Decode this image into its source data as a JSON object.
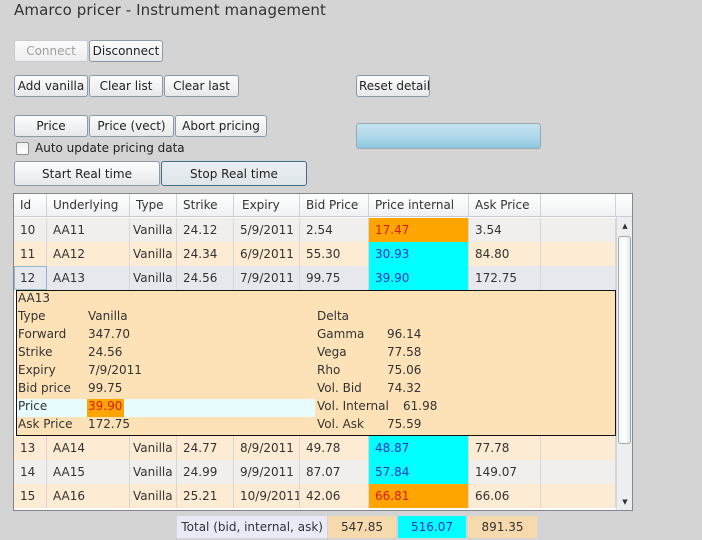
{
  "window": {
    "title": "Amarco pricer - Instrument management"
  },
  "toolbar": {
    "connect": "Connect",
    "disconnect": "Disconnect",
    "add_vanilla": "Add vanilla",
    "clear_list": "Clear list",
    "clear_last": "Clear last",
    "reset_details": "Reset details",
    "price": "Price",
    "price_vect": "Price (vect)",
    "abort_pricing": "Abort pricing",
    "auto_update_label": "Auto update pricing data",
    "auto_update_checked": false,
    "start_real_time": "Start Real time",
    "stop_real_time": "Stop Real time",
    "progress_fraction": 1.0
  },
  "colors": {
    "orange_highlight": "#ffa500",
    "cyan_highlight": "#00ffff",
    "details_background": "#fde2b8"
  },
  "grid": {
    "columns": [
      "Id",
      "Underlying",
      "Type",
      "Strike",
      "Expiry",
      "Bid Price",
      "Price internal",
      "Ask Price"
    ],
    "rows_top": [
      {
        "id": "10",
        "underlying": "AA11",
        "type": "Vanilla",
        "strike": "24.12",
        "expiry": "5/9/2011",
        "bid": "2.54",
        "internal": "17.47",
        "internal_color": "orange",
        "ask": "3.54"
      },
      {
        "id": "11",
        "underlying": "AA12",
        "type": "Vanilla",
        "strike": "24.34",
        "expiry": "6/9/2011",
        "bid": "55.30",
        "internal": "30.93",
        "internal_color": "cyan",
        "ask": "84.80"
      },
      {
        "id": "12",
        "underlying": "AA13",
        "type": "Vanilla",
        "strike": "24.56",
        "expiry": "7/9/2011",
        "bid": "99.75",
        "internal": "39.90",
        "internal_color": "cyan",
        "ask": "172.75"
      }
    ],
    "rows_bottom": [
      {
        "id": "13",
        "underlying": "AA14",
        "type": "Vanilla",
        "strike": "24.77",
        "expiry": "8/9/2011",
        "bid": "49.78",
        "internal": "48.87",
        "internal_color": "cyan",
        "ask": "77.78"
      },
      {
        "id": "14",
        "underlying": "AA15",
        "type": "Vanilla",
        "strike": "24.99",
        "expiry": "9/9/2011",
        "bid": "87.07",
        "internal": "57.84",
        "internal_color": "cyan",
        "ask": "149.07"
      },
      {
        "id": "15",
        "underlying": "AA16",
        "type": "Vanilla",
        "strike": "25.21",
        "expiry": "10/9/2011",
        "bid": "42.06",
        "internal": "66.81",
        "internal_color": "orange",
        "ask": "66.06"
      }
    ]
  },
  "details": {
    "name": "AA13",
    "left": [
      {
        "label": "Type",
        "value": "Vanilla"
      },
      {
        "label": "Forward",
        "value": "347.70"
      },
      {
        "label": "Strike",
        "value": "24.56"
      },
      {
        "label": "Expiry",
        "value": "7/9/2011"
      },
      {
        "label": "Bid price",
        "value": "99.75"
      },
      {
        "label": "Price",
        "value": "39.90"
      },
      {
        "label": "Ask Price",
        "value": "172.75"
      }
    ],
    "right": [
      {
        "label": "Delta",
        "value": ""
      },
      {
        "label": "Gamma",
        "value": "96.14"
      },
      {
        "label": "Vega",
        "value": "77.58"
      },
      {
        "label": "Rho",
        "value": "75.06"
      },
      {
        "label": "Vol. Bid",
        "value": "74.32"
      },
      {
        "label": "Vol. Internal",
        "value": "61.98"
      },
      {
        "label": "Vol. Ask",
        "value": "75.59"
      }
    ]
  },
  "totals": {
    "label": "Total (bid, internal, ask)",
    "bid": "547.85",
    "internal": "516.07",
    "ask": "891.35"
  }
}
